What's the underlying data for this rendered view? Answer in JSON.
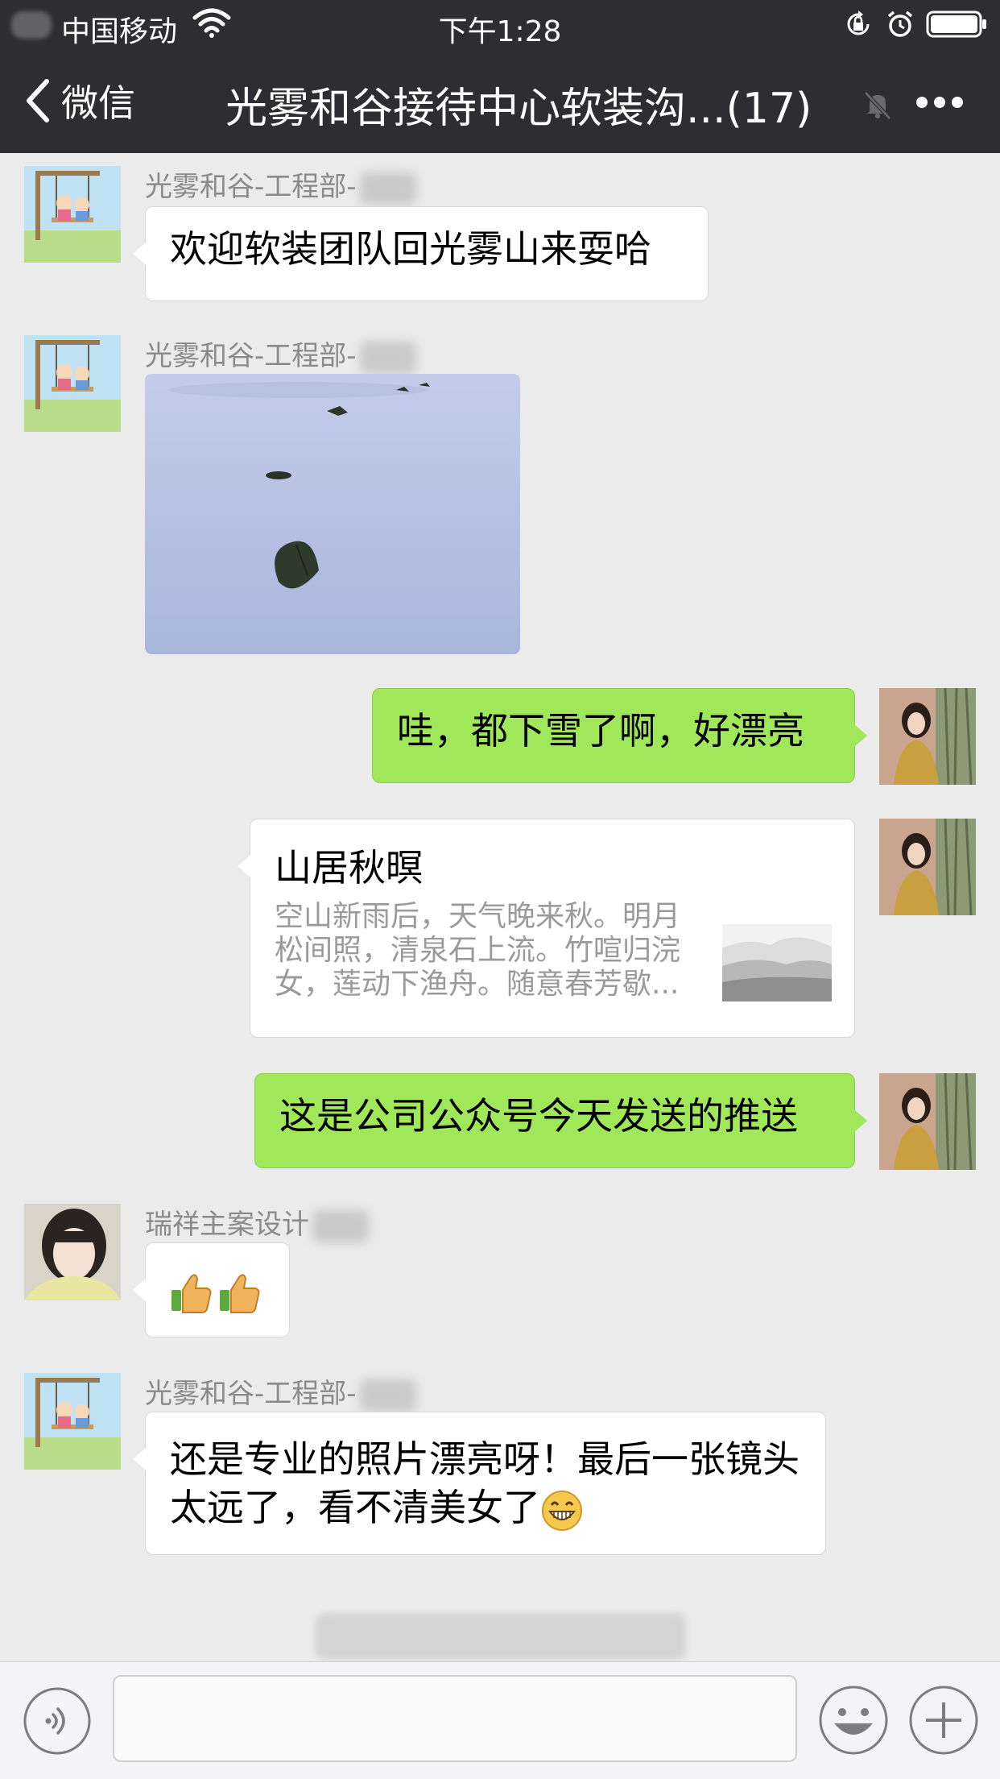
{
  "status_bar": {
    "carrier": "中国移动",
    "time": "下午1:28"
  },
  "nav": {
    "back_label": "微信",
    "title": "光雾和谷接待中心软装沟...(17)"
  },
  "messages": [
    {
      "sender": "光雾和谷-工程部-",
      "text": "欢迎软装团队回光雾山来耍哈"
    },
    {
      "sender": "光雾和谷-工程部-",
      "image": "snow-leaves-photo"
    },
    {
      "self": true,
      "text": "哇，都下雪了啊，好漂亮"
    },
    {
      "self": true,
      "card": {
        "title": "山居秋暝",
        "description": "空山新雨后，天气晚来秋。明月松间照，清泉石上流。竹喧归浣女，莲动下渔舟。随意春芳歇..."
      }
    },
    {
      "self": true,
      "text": "这是公司公众号今天发送的推送"
    },
    {
      "sender": "瑞祥主案设计",
      "emojis": [
        "thumbs-up",
        "thumbs-up"
      ]
    },
    {
      "sender": "光雾和谷-工程部-",
      "text": "还是专业的照片漂亮呀！最后一张镜头太远了，看不清美女了",
      "emoji": "grin"
    }
  ],
  "colors": {
    "nav_bg": "#2e2d32",
    "chat_bg": "#ebebeb",
    "self_bubble": "#a0e75a",
    "other_bubble": "#ffffff"
  }
}
